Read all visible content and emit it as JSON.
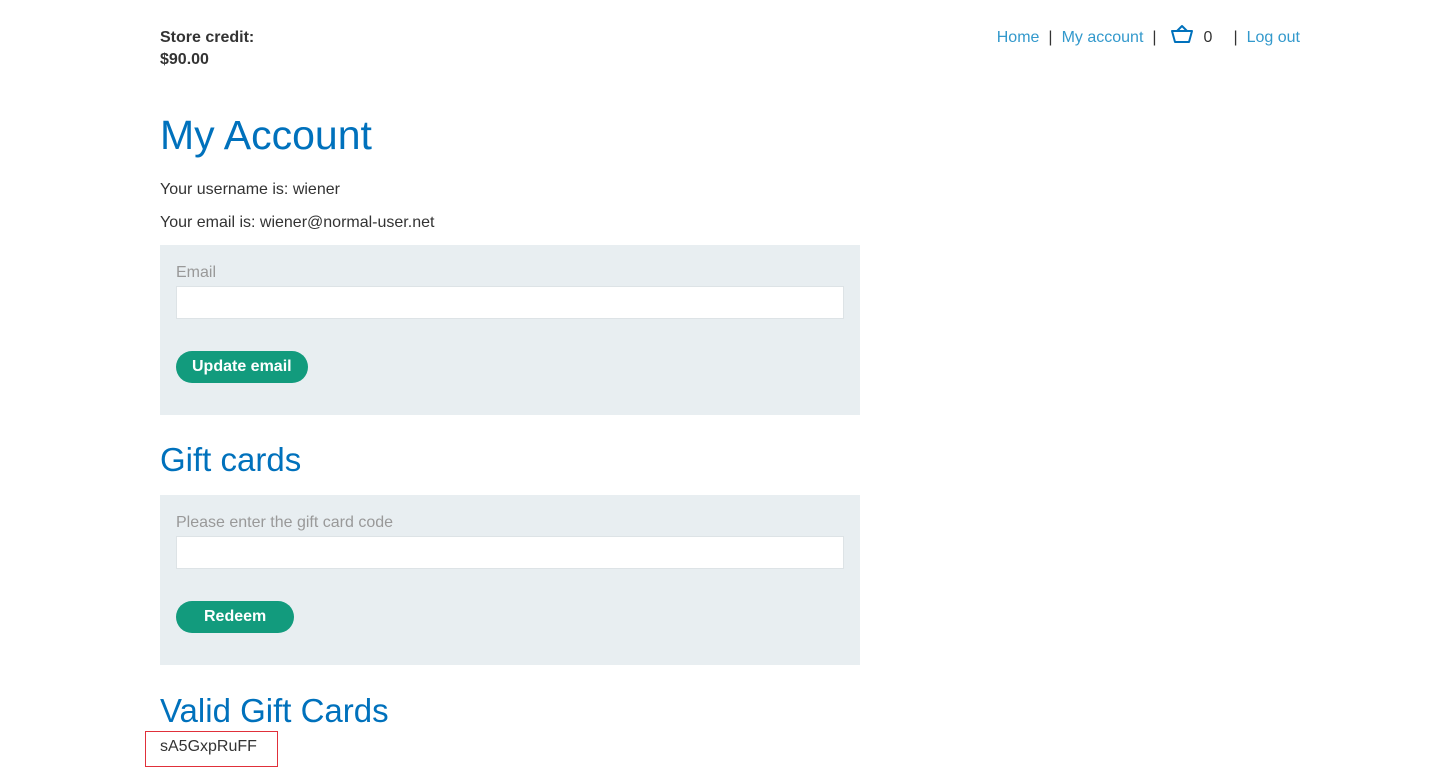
{
  "store_credit": {
    "label": "Store credit:",
    "amount": "$90.00"
  },
  "nav": {
    "home": "Home",
    "my_account": "My account",
    "separator": "|",
    "cart_icon": "basket-icon",
    "cart_count": "0",
    "log_out": "Log out"
  },
  "account": {
    "title": "My Account",
    "username_line": "Your username is: wiener",
    "email_line": "Your email is: wiener@normal-user.net"
  },
  "email_form": {
    "label": "Email",
    "value": "",
    "button": "Update email"
  },
  "gift_cards": {
    "title": "Gift cards",
    "label": "Please enter the gift card code",
    "value": "",
    "button": "Redeem"
  },
  "valid_gift_cards": {
    "title": "Valid Gift Cards",
    "codes": [
      "sA5GxpRuFF"
    ]
  },
  "colors": {
    "link": "#3399cc",
    "heading": "#0071bc",
    "button": "#129b7d",
    "panel": "#e8eef1",
    "highlight_border": "#e0303a"
  }
}
